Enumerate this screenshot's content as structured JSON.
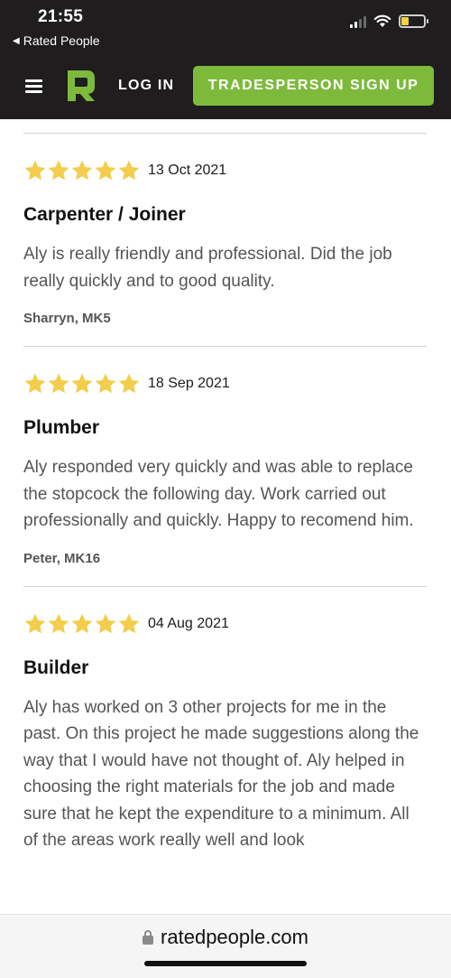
{
  "status_bar": {
    "time": "21:55",
    "back_app": "Rated People"
  },
  "nav": {
    "login_label": "LOG IN",
    "signup_label": "TRADESPERSON SIGN UP",
    "brand_color": "#7dba3c",
    "logo_icon": "rated-people-logo-icon",
    "menu_icon": "hamburger-menu-icon"
  },
  "reviews": [
    {
      "stars": 5,
      "date": "13 Oct 2021",
      "trade": "Carpenter / Joiner",
      "text": "Aly is really friendly and professional. Did the job really quickly and to good quality.",
      "reviewer": "Sharryn, MK5"
    },
    {
      "stars": 5,
      "date": "18 Sep 2021",
      "trade": "Plumber",
      "text": "Aly responded very quickly and was able to replace the stopcock the following day. Work carried out professionally and quickly. Happy to recomend him.",
      "reviewer": "Peter, MK16"
    },
    {
      "stars": 5,
      "date": "04 Aug 2021",
      "trade": "Builder",
      "text": "Aly has worked on 3 other projects for me in the past. On this project he made suggestions along the way that I would have not thought of. Aly helped in choosing the right materials for the job and made sure that he kept the expenditure to a minimum. All of the areas work really well and look",
      "reviewer": ""
    }
  ],
  "star_color": "#f3cd4b",
  "browser": {
    "url": "ratedpeople.com"
  }
}
